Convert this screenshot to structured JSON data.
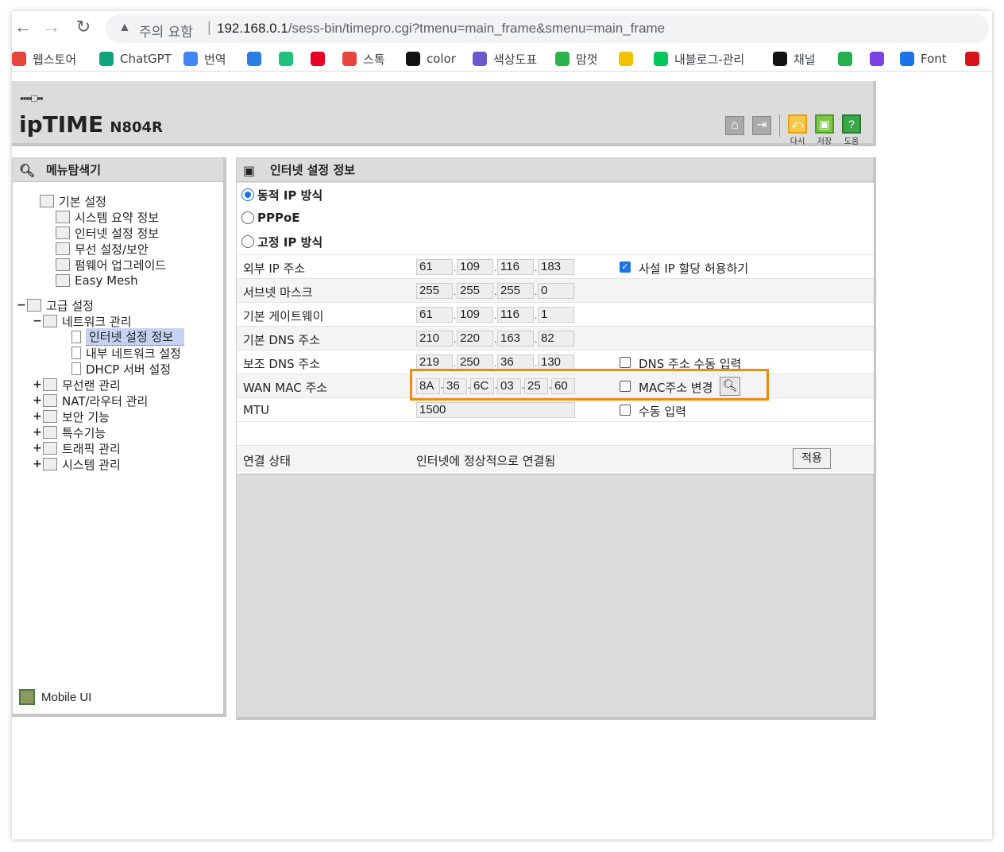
{
  "browser": {
    "nav": {
      "back": "←",
      "forward": "→",
      "reload": "↻"
    },
    "security_label": "주의 요함",
    "url_host": "192.168.0.1",
    "url_path": "/sess-bin/timepro.cgi?tmenu=main_frame&smenu=main_frame",
    "bookmarks": [
      {
        "label": "웹스토어",
        "icon": "webstore-icon",
        "color": "#e8453c"
      },
      {
        "label": "ChatGPT",
        "icon": "chatgpt-icon",
        "color": "#10a37f"
      },
      {
        "label": "번역",
        "icon": "translate-icon",
        "color": "#4285f4"
      },
      {
        "label": "",
        "icon": "bot-icon",
        "color": "#2a7de1"
      },
      {
        "label": "",
        "icon": "m-icon",
        "color": "#21c17b"
      },
      {
        "label": "",
        "icon": "pinterest-icon",
        "color": "#e60023"
      },
      {
        "label": "스톡",
        "icon": "stock-icon",
        "color": "#e8453c"
      },
      {
        "label": "color",
        "icon": "color-icon",
        "color": "#111111"
      },
      {
        "label": "색상도표",
        "icon": "palette-icon",
        "color": "#6a5acd"
      },
      {
        "label": "맘껏",
        "icon": "cup-icon",
        "color": "#2bb24c"
      },
      {
        "label": "",
        "icon": "face-icon",
        "color": "#f2c200"
      },
      {
        "label": "내블로그-관리",
        "icon": "blog-icon",
        "color": "#03c75a"
      },
      {
        "label": "채널",
        "icon": "channel-icon",
        "color": "#111111"
      },
      {
        "label": "",
        "icon": "px-icon",
        "color": "#22b14c"
      },
      {
        "label": "",
        "icon": "w-icon",
        "color": "#7b3fe4"
      },
      {
        "label": "Font",
        "icon": "font-icon",
        "color": "#1a73e8"
      },
      {
        "label": "",
        "icon": "red-icon",
        "color": "#d7141a"
      }
    ]
  },
  "router": {
    "brand_dots": "▪▪▪▪□▪▪",
    "brand": "ipTIME",
    "model": "N804R",
    "toolbar": {
      "redo": "다시",
      "save": "저장",
      "help": "도움"
    },
    "menu_title": "메뉴탐색기",
    "tree": [
      {
        "label": "기본 설정",
        "toggle": ""
      },
      {
        "label": "시스템 요약 정보",
        "toggle": ""
      },
      {
        "label": "인터넷 설정 정보",
        "toggle": ""
      },
      {
        "label": "무선 설정/보안",
        "toggle": ""
      },
      {
        "label": "펌웨어 업그레이드",
        "toggle": ""
      },
      {
        "label": "Easy Mesh",
        "toggle": ""
      },
      {
        "label": "고급 설정",
        "toggle": "−"
      },
      {
        "label": "네트워크 관리",
        "toggle": "−"
      },
      {
        "label": "인터넷 설정 정보",
        "toggle": ""
      },
      {
        "label": "내부 네트워크 설정",
        "toggle": ""
      },
      {
        "label": "DHCP 서버 설정",
        "toggle": ""
      },
      {
        "label": "무선랜 관리",
        "toggle": "+"
      },
      {
        "label": "NAT/라우터 관리",
        "toggle": "+"
      },
      {
        "label": "보안 기능",
        "toggle": "+"
      },
      {
        "label": "특수기능",
        "toggle": "+"
      },
      {
        "label": "트래픽 관리",
        "toggle": "+"
      },
      {
        "label": "시스템 관리",
        "toggle": "+"
      }
    ],
    "mobile_ui": "Mobile UI",
    "panel_title": "인터넷 설정 정보",
    "modes": [
      "동적 IP 방식",
      "PPPoE",
      "고정 IP 방식"
    ],
    "selected_mode": "동적 IP 방식",
    "fields": {
      "wan_ip": {
        "label": "외부 IP 주소",
        "octets": [
          "61",
          "109",
          "116",
          "183"
        ]
      },
      "subnet": {
        "label": "서브넷 마스크",
        "octets": [
          "255",
          "255",
          "255",
          "0"
        ]
      },
      "gateway": {
        "label": "기본 게이트웨이",
        "octets": [
          "61",
          "109",
          "116",
          "1"
        ]
      },
      "dns1": {
        "label": "기본 DNS 주소",
        "octets": [
          "210",
          "220",
          "163",
          "82"
        ]
      },
      "dns2": {
        "label": "보조 DNS 주소",
        "octets": [
          "219",
          "250",
          "36",
          "130"
        ]
      },
      "mac": {
        "label": "WAN MAC 주소",
        "parts": [
          "8A",
          "36",
          "6C",
          "03",
          "25",
          "60"
        ]
      },
      "mtu": {
        "label": "MTU",
        "value": "1500"
      }
    },
    "options": {
      "private_ip": {
        "label": "사설 IP 할당 허용하기",
        "checked": true
      },
      "dns_manual": {
        "label": "DNS 주소 수동 입력",
        "checked": false
      },
      "mac_change": {
        "label": "MAC주소 변경",
        "checked": false
      },
      "mtu_manual": {
        "label": "수동 입력",
        "checked": false
      }
    },
    "status_label": "연결 상태",
    "status_value": "인터넷에 정상적으로 연결됨",
    "apply": "적용"
  }
}
